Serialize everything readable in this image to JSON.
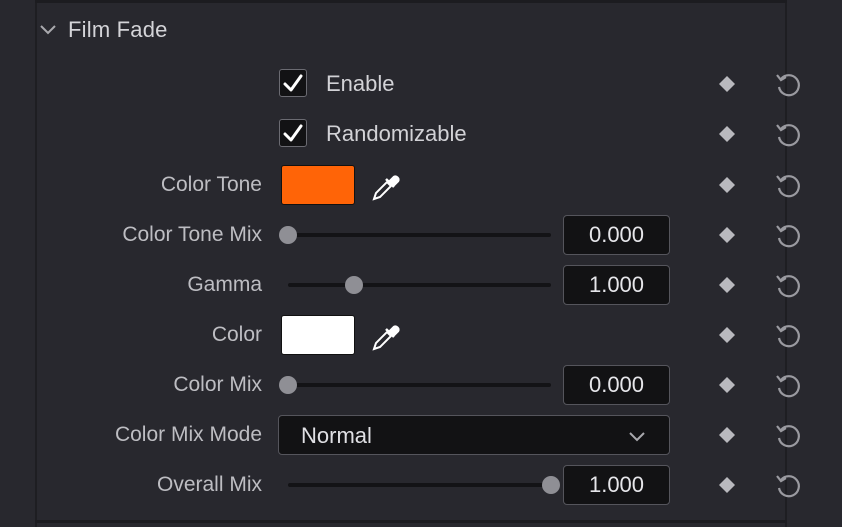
{
  "section": {
    "title": "Film Fade",
    "expanded": true
  },
  "controls": {
    "enable": {
      "label": "Enable",
      "checked": true
    },
    "randomizable": {
      "label": "Randomizable",
      "checked": true
    },
    "color_tone": {
      "label": "Color Tone",
      "color": "#ff6407"
    },
    "color_tone_mix": {
      "label": "Color Tone Mix",
      "value": "0.000",
      "fraction": 0.0
    },
    "gamma": {
      "label": "Gamma",
      "value": "1.000",
      "fraction": 0.25
    },
    "color": {
      "label": "Color",
      "color": "#ffffff"
    },
    "color_mix": {
      "label": "Color Mix",
      "value": "0.000",
      "fraction": 0.0
    },
    "color_mix_mode": {
      "label": "Color Mix Mode",
      "value": "Normal"
    },
    "overall_mix": {
      "label": "Overall Mix",
      "value": "1.000",
      "fraction": 1.0
    }
  },
  "icons": {
    "section_toggle": "chevron-down-icon",
    "eyedropper": "eyedropper-icon",
    "keyframe": "keyframe-diamond-icon",
    "reset": "reset-icon"
  },
  "colors": {
    "background": "#28282e",
    "field": "#121214",
    "accent_tone": "#ff6407"
  }
}
